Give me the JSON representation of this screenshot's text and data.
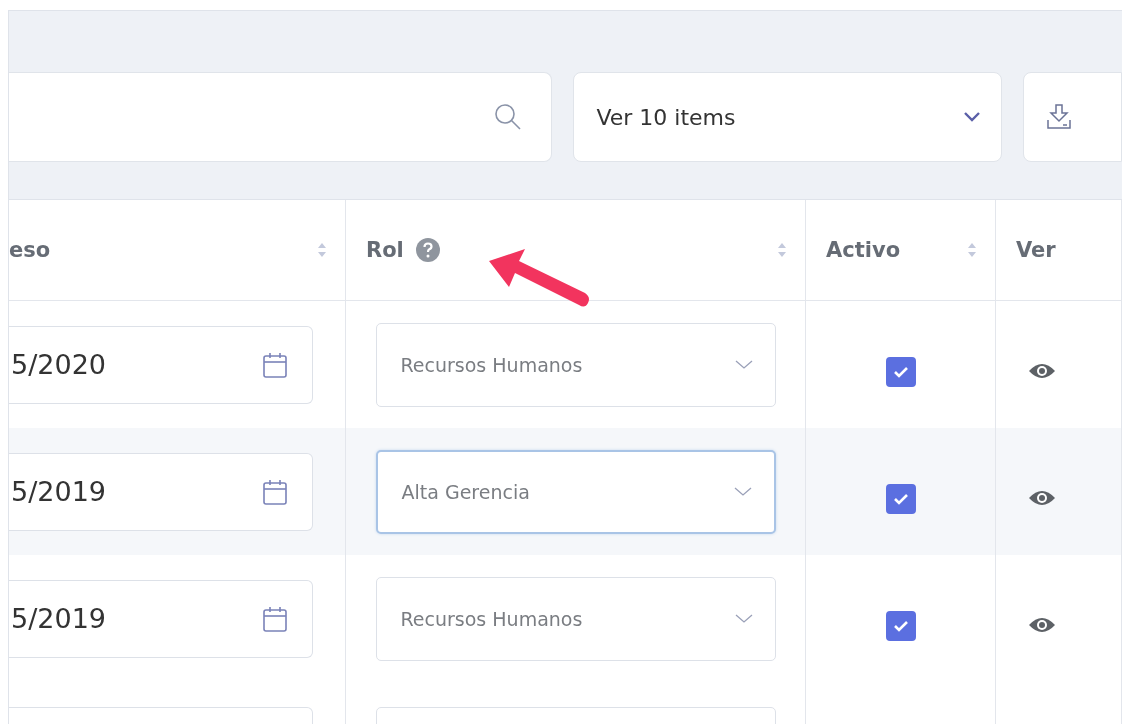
{
  "toolbar": {
    "page_size": "Ver 10 items"
  },
  "columns": [
    {
      "label": "eso",
      "sortable": true,
      "help": false
    },
    {
      "label": "Rol",
      "sortable": true,
      "help": true
    },
    {
      "label": "Activo",
      "sortable": true,
      "help": false
    },
    {
      "label": "Ver",
      "sortable": false,
      "help": false
    }
  ],
  "rows": [
    {
      "date": "5/2020",
      "role": "Recursos Humanos",
      "role_focused": false,
      "active": true
    },
    {
      "date": "5/2019",
      "role": "Alta Gerencia",
      "role_focused": true,
      "active": true
    },
    {
      "date": "5/2019",
      "role": "Recursos Humanos",
      "role_focused": false,
      "active": true
    }
  ]
}
